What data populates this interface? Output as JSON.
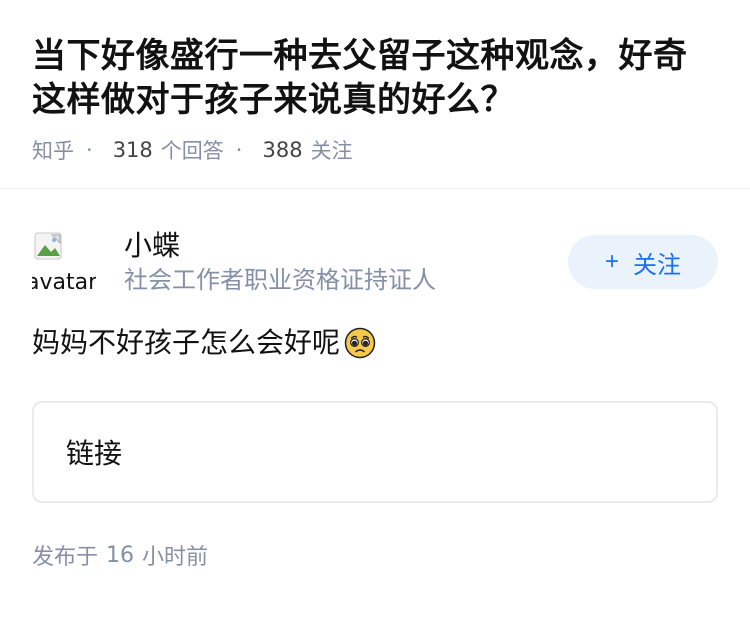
{
  "question": {
    "title": "当下好像盛行一种去父留子这种观念，好奇这样做对于孩子来说真的好么？",
    "source": "知乎",
    "answer_count": "318",
    "answer_label": "个回答",
    "follower_count": "388",
    "follower_label": "关注"
  },
  "author": {
    "avatar_alt": "avatar",
    "name": "小蝶",
    "bio": "社会工作者职业资格证持证人",
    "follow_plus": "+",
    "follow_label": "关注"
  },
  "answer": {
    "text": "妈妈不好孩子怎么会好呢",
    "emoji_icon": "pleading-face-icon"
  },
  "link_card": {
    "label": "链接"
  },
  "footer": {
    "published_prefix": "发布于",
    "published_number": "16",
    "published_suffix": "小时前"
  }
}
